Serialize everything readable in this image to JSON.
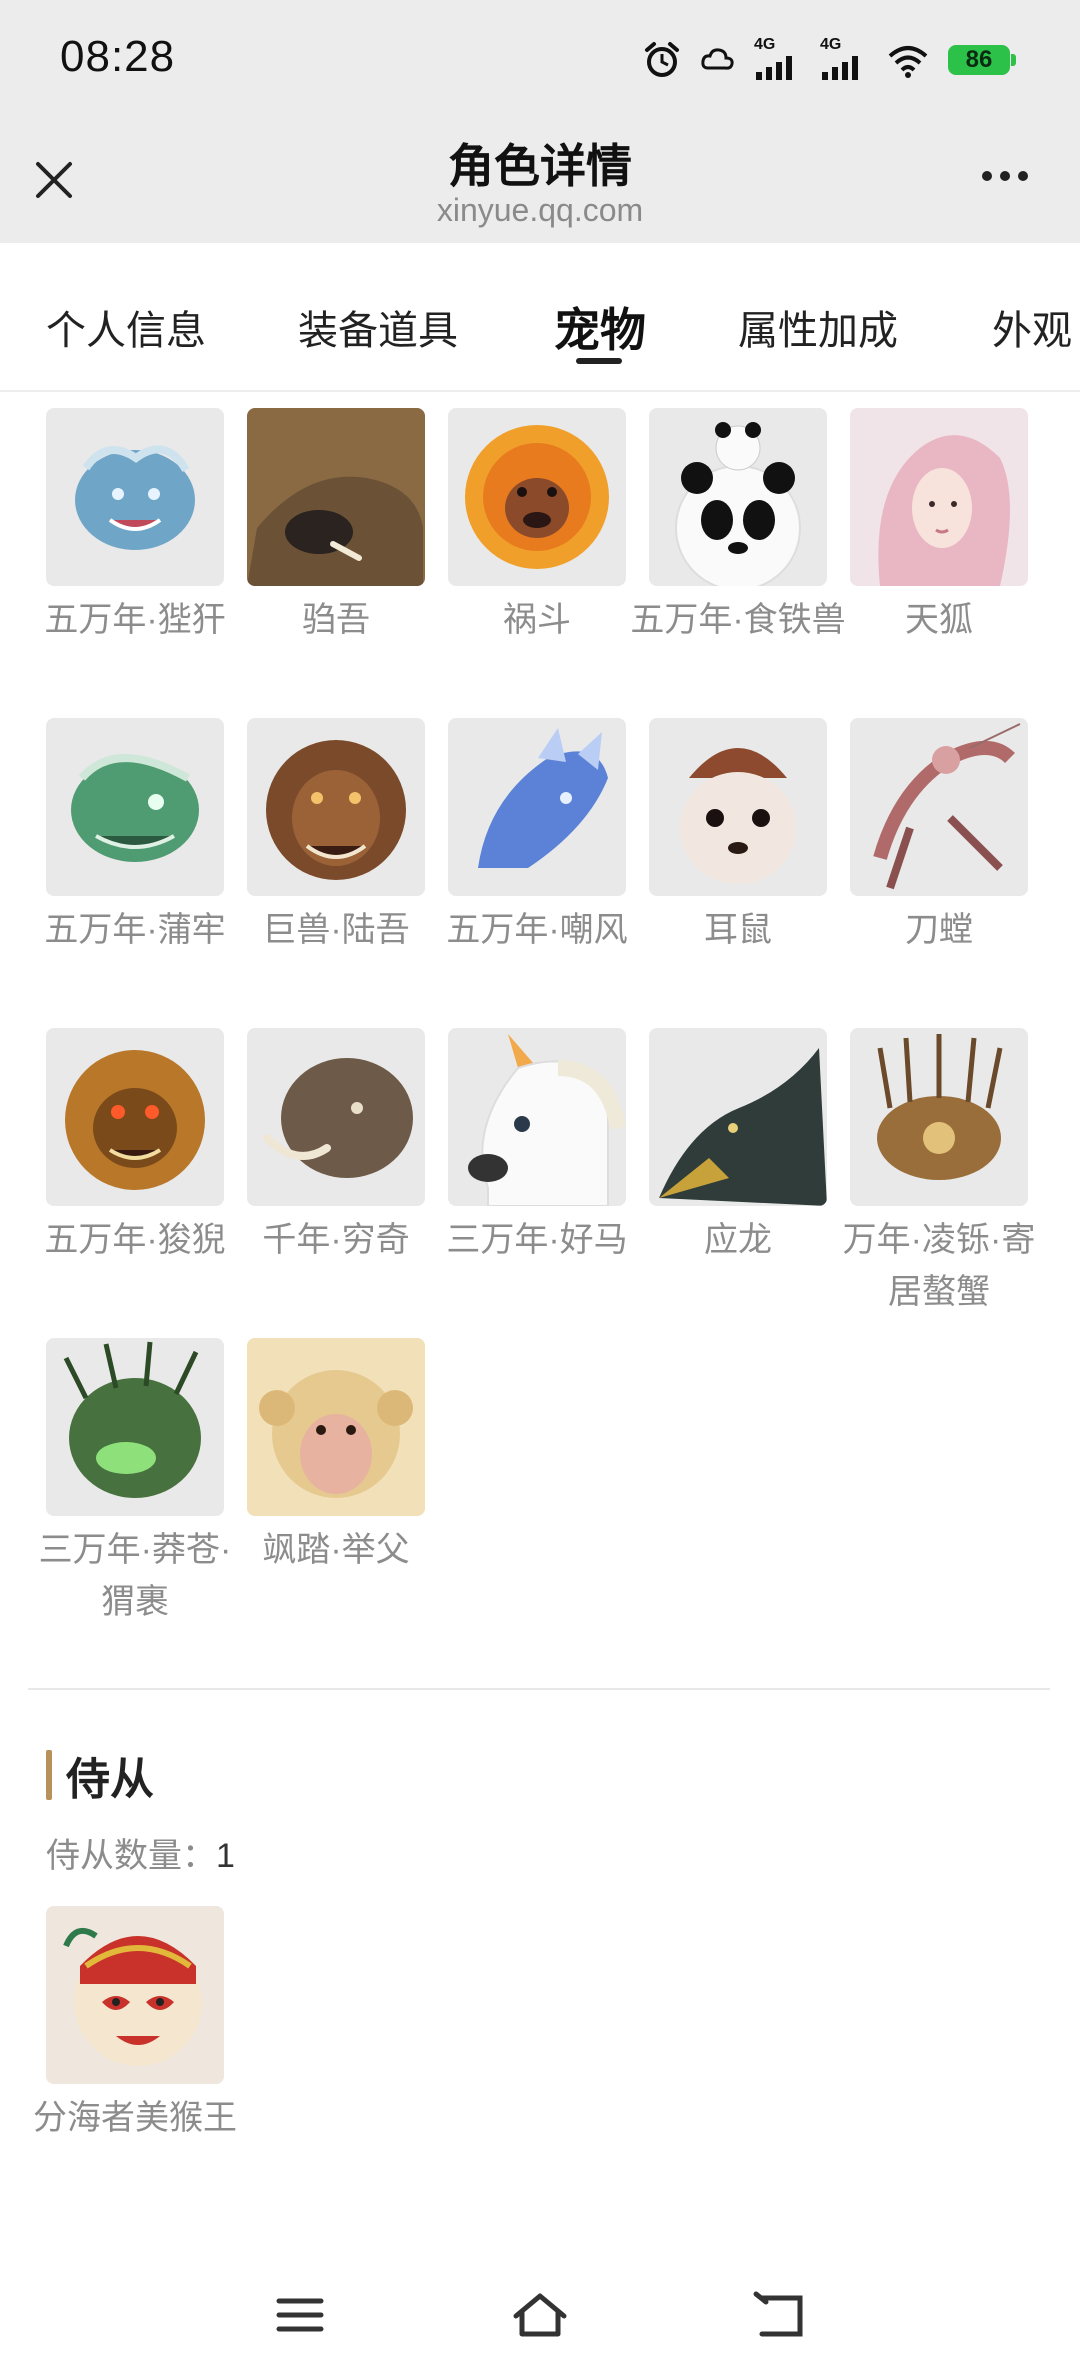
{
  "status_bar": {
    "time": "08:28",
    "network_1": "4G",
    "network_2": "4G",
    "battery": "86",
    "battery_color": "#2cc24a"
  },
  "title_bar": {
    "title": "角色详情",
    "subtitle": "xinyue.qq.com"
  },
  "tabs": [
    {
      "label": "个人信息",
      "active": false
    },
    {
      "label": "装备道具",
      "active": false
    },
    {
      "label": "宠物",
      "active": true
    },
    {
      "label": "属性加成",
      "active": false
    },
    {
      "label": "外观",
      "active": false
    }
  ],
  "pets": [
    {
      "name": "五万年·狴犴",
      "icon": "blue-dragon-beast",
      "color": "#6fa6c8"
    },
    {
      "name": "驺吾",
      "icon": "brown-boar-beast",
      "color": "#6b5236"
    },
    {
      "name": "祸斗",
      "icon": "fire-lion-beast",
      "color": "#e77b1d"
    },
    {
      "name": "五万年·食铁兽",
      "icon": "panda",
      "color": "#f3f3f3"
    },
    {
      "name": "天狐",
      "icon": "fox-spirit-woman",
      "color": "#e9b7c4"
    },
    {
      "name": "五万年·蒲牢",
      "icon": "green-jade-dragon",
      "color": "#4f9c72"
    },
    {
      "name": "巨兽·陆吾",
      "icon": "brown-tiger-beast",
      "color": "#7a4a2a"
    },
    {
      "name": "五万年·嘲风",
      "icon": "ice-dragon",
      "color": "#5b82d6"
    },
    {
      "name": "耳鼠",
      "icon": "white-mouse",
      "color": "#f1e7e0"
    },
    {
      "name": "刀螳",
      "icon": "mantis",
      "color": "#b06a6a"
    },
    {
      "name": "五万年·狻猊",
      "icon": "golden-lion-beast",
      "color": "#b9772a"
    },
    {
      "name": "千年·穷奇",
      "icon": "tusked-beast",
      "color": "#6d5a48"
    },
    {
      "name": "三万年·好马",
      "icon": "white-unicorn",
      "color": "#fafafa"
    },
    {
      "name": "应龙",
      "icon": "dark-dragon",
      "color": "#2f3c3a"
    },
    {
      "name": "万年·凌铄·寄居螯蟹",
      "icon": "spiky-crab",
      "color": "#9a6e3a"
    },
    {
      "name": "三万年·莽苍·猬裹",
      "icon": "green-hedgehog",
      "color": "#47713f"
    },
    {
      "name": "飒踏·举父",
      "icon": "monkey-face",
      "color": "#e6c98f"
    }
  ],
  "attendants": {
    "title": "侍从",
    "count_label": "侍从数量：",
    "count": "1",
    "accent_color": "#b7915b",
    "items": [
      {
        "name": "分海者美猴王",
        "icon": "monkey-king-mask",
        "color": "#c8322a"
      }
    ]
  },
  "nav_bar": {
    "menu_icon": "menu-icon",
    "home_icon": "home-icon",
    "back_icon": "back-icon"
  }
}
